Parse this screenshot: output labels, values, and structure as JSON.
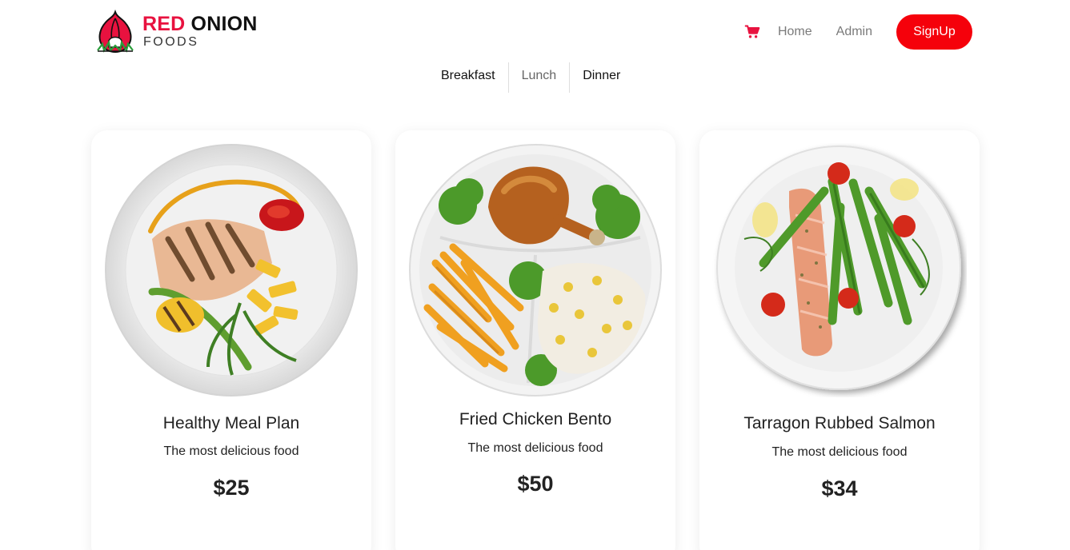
{
  "brand": {
    "name_red": "RED",
    "name_dark": "ONION",
    "sub": "FOODS",
    "accent": "#e8123f"
  },
  "nav": {
    "cart_icon": "cart-icon",
    "home": "Home",
    "admin": "Admin",
    "signup": "SignUp",
    "signup_color": "#f5010b"
  },
  "tabs": [
    {
      "label": "Breakfast",
      "active": false
    },
    {
      "label": "Lunch",
      "active": true
    },
    {
      "label": "Dinner",
      "active": false
    }
  ],
  "products": [
    {
      "name": "Healthy Meal Plan",
      "description": "The most delicious food",
      "price": "$25"
    },
    {
      "name": "Fried Chicken Bento",
      "description": "The most delicious food",
      "price": "$50"
    },
    {
      "name": "Tarragon Rubbed Salmon",
      "description": "The most delicious food",
      "price": "$34"
    }
  ]
}
